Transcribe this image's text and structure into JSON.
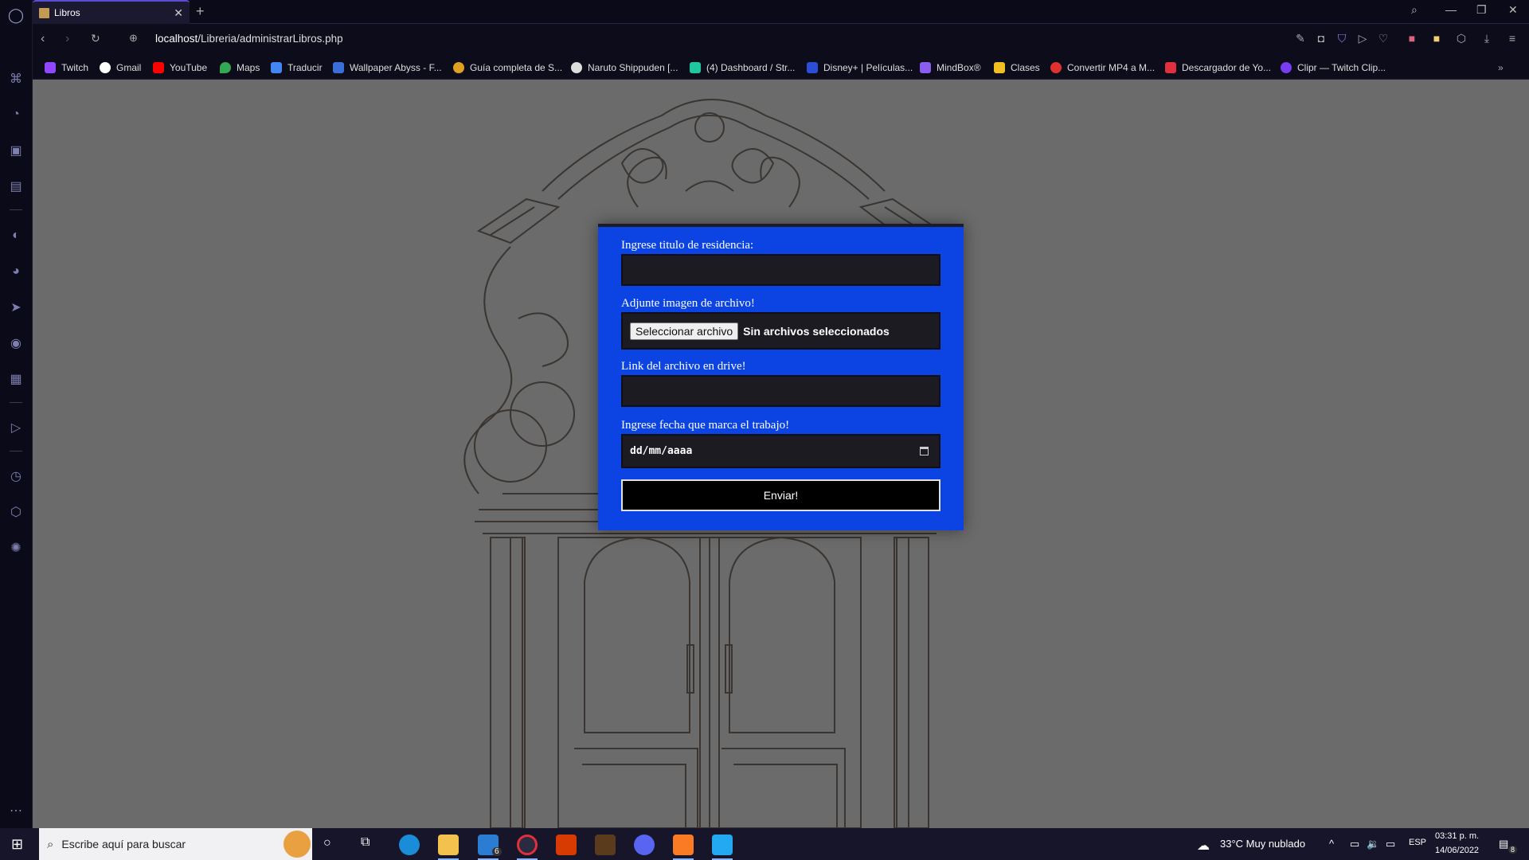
{
  "browser": {
    "tab_title": "Libros",
    "new_tab": "+",
    "url_host": "localhost",
    "url_path": "/Libreria/administrarLibros.php"
  },
  "bookmarks": [
    {
      "label": "Twitch",
      "color": "#9146ff"
    },
    {
      "label": "Gmail",
      "color": "#ffffff"
    },
    {
      "label": "YouTube",
      "color": "#ff0000"
    },
    {
      "label": "Maps",
      "color": "#34a853"
    },
    {
      "label": "Traducir",
      "color": "#4285f4"
    },
    {
      "label": "Wallpaper Abyss - F...",
      "color": "#3a6fd8"
    },
    {
      "label": "Guía completa de S...",
      "color": "#e0a020"
    },
    {
      "label": "Naruto Shippuden [...",
      "color": "#dddddd"
    },
    {
      "label": "(4) Dashboard / Str...",
      "color": "#1ec7a0"
    },
    {
      "label": "Disney+ | Películas...",
      "color": "#2b4dd8"
    },
    {
      "label": "MindBox®",
      "color": "#8a5cf0"
    },
    {
      "label": "Clases",
      "color": "#f0c020"
    },
    {
      "label": "Convertir MP4 a M...",
      "color": "#e03030"
    },
    {
      "label": "Descargador de Yo...",
      "color": "#e03040"
    },
    {
      "label": "Clipr — Twitch Clip...",
      "color": "#7a3cf0"
    }
  ],
  "form": {
    "title_label": "Ingrese titulo de residencia:",
    "title_value": "",
    "image_label": "Adjunte imagen de archivo!",
    "file_button": "Seleccionar archivo",
    "file_status": "Sin archivos seleccionados",
    "drive_label": "Link del archivo en drive!",
    "drive_value": "",
    "date_label": "Ingrese fecha que marca el trabajo!",
    "date_placeholder": "dd/mm/aaaa",
    "submit": "Enviar!"
  },
  "taskbar": {
    "search_placeholder": "Escribe aquí para buscar",
    "weather": "33°C  Muy nublado",
    "language": "ESP",
    "time": "03:31 p. m.",
    "date": "14/06/2022",
    "mail_badge": "6",
    "notif_badge": "8"
  },
  "colors": {
    "form_bg": "#0b44e3",
    "page_bg": "#6b6b6b",
    "sidebar_bg": "#0a0a18"
  }
}
